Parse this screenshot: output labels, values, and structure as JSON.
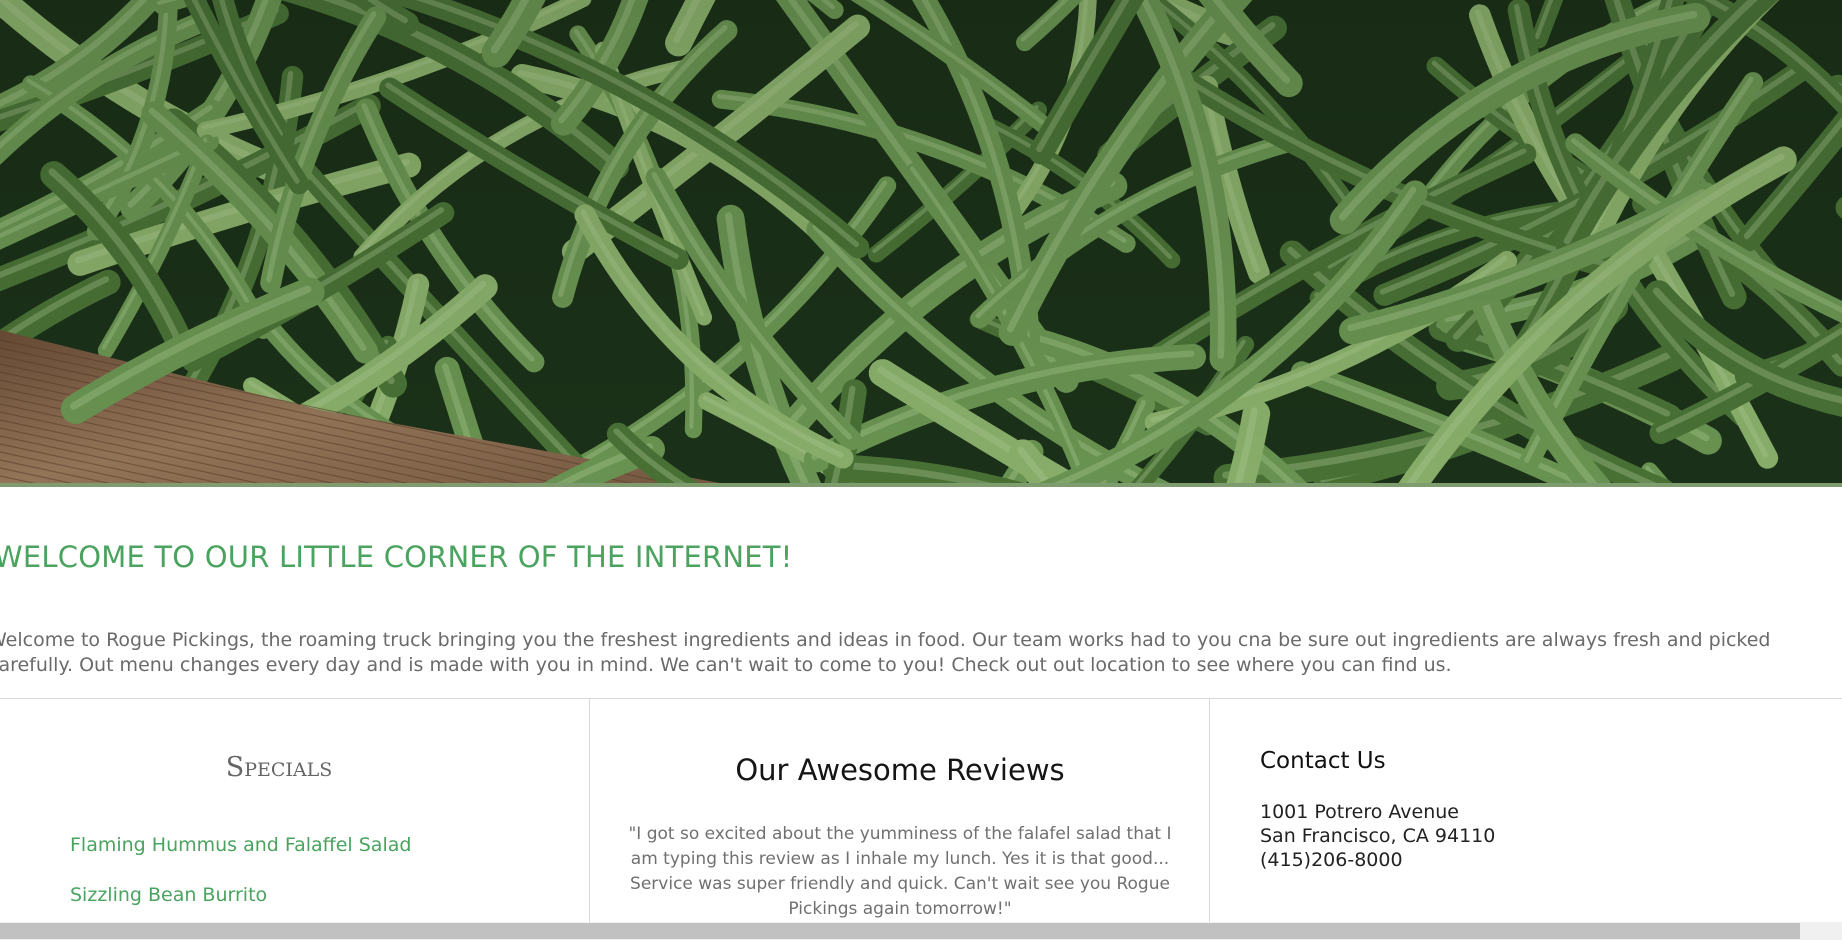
{
  "hero": {
    "image": "green-beans-photo",
    "colors": {
      "dark": "#1c3319",
      "bean_light": "#8fb66f",
      "bean_mid": "#6e9a55",
      "bean_dark": "#4c7638",
      "wood": "#8a6a4e",
      "rule": "#7f9c6e"
    }
  },
  "welcome": {
    "title": "WELCOME TO OUR LITTLE CORNER OF THE INTERNET!",
    "line1": "Welcome to Rogue Pickings, the roaming truck bringing you the freshest ingredients and ideas in food. Our team works had to you cna be sure out ingredients are always fresh and picked",
    "line2": "carefully. Out menu changes every day and is made with you in mind. We can't wait to come to you! Check out out location to see where you can find us."
  },
  "specials": {
    "heading": "Specials",
    "items": [
      {
        "label": "Flaming Hummus and Falaffel Salad"
      },
      {
        "label": "Sizzling Bean Burrito"
      }
    ]
  },
  "reviews": {
    "heading": "Our Awesome Reviews",
    "text": "\"I got so excited about the yumminess of the falafel salad that I am typing this review as I inhale my lunch. Yes it is that good... Service was super friendly and quick. Can't wait see you Rogue Pickings again tomorrow!\""
  },
  "contact": {
    "heading": "Contact Us",
    "street": "1001 Potrero Avenue",
    "city": "San Francisco, CA 94110",
    "phone": "(415)206-8000"
  },
  "colors": {
    "accent_green": "#4aa35f",
    "body_text": "#6a6a6a",
    "divider": "#d8d8d8",
    "scrollbar_thumb": "#c1c1c1"
  }
}
